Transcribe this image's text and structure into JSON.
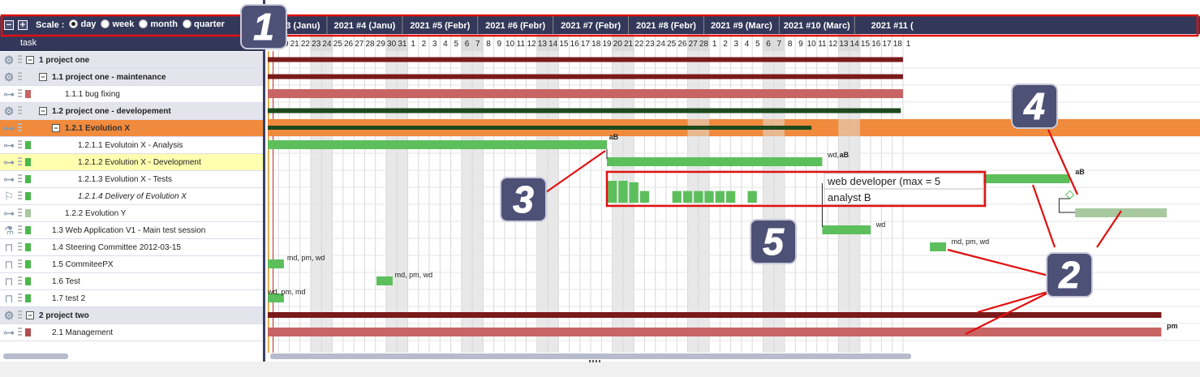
{
  "toolbar": {
    "collapse_label": "−",
    "expand_label": "+",
    "scale_label": "Scale :",
    "scale_options": [
      {
        "label": "day",
        "checked": true
      },
      {
        "label": "week",
        "checked": false
      },
      {
        "label": "month",
        "checked": false
      },
      {
        "label": "quarter",
        "checked": false
      }
    ]
  },
  "task_header": "task",
  "weeks": [
    "2021 #3 (Janu)",
    "2021 #4 (Janu)",
    "2021 #5 (Febr)",
    "2021 #6 (Febr)",
    "2021 #7 (Febr)",
    "2021 #8 (Febr)",
    "2021 #9 (Marc)",
    "2021 #10 (Marc)",
    "2021 #11 ("
  ],
  "days": [
    "19",
    "20",
    "21",
    "22",
    "23",
    "24",
    "25",
    "26",
    "27",
    "28",
    "29",
    "30",
    "31",
    "1",
    "2",
    "3",
    "4",
    "5",
    "6",
    "7",
    "8",
    "9",
    "10",
    "11",
    "12",
    "13",
    "14",
    "15",
    "16",
    "17",
    "18",
    "19",
    "20",
    "21",
    "22",
    "23",
    "24",
    "25",
    "26",
    "27",
    "28",
    "1",
    "2",
    "3",
    "4",
    "5",
    "6",
    "7",
    "8",
    "9",
    "10",
    "11",
    "12",
    "13",
    "14",
    "15",
    "16",
    "17",
    "18",
    "1"
  ],
  "weekend_day_indices": [
    4,
    5,
    11,
    12,
    18,
    19,
    25,
    26,
    32,
    33,
    39,
    40,
    46,
    47,
    53,
    54
  ],
  "tasks": [
    {
      "label": "1 project one",
      "level": 0,
      "group": true,
      "icon": "gear",
      "color": "#7a1a1a",
      "toggle": "−"
    },
    {
      "label": "1.1 project one - maintenance",
      "level": 1,
      "group": true,
      "icon": "gear",
      "color": "#7a1a1a",
      "toggle": "−"
    },
    {
      "label": "1.1.1 bug fixing",
      "level": 2,
      "icon": "tree",
      "color": "#c86464"
    },
    {
      "label": "1.2 project one - developement",
      "level": 1,
      "group": true,
      "icon": "gear",
      "color": "#1d4a1d",
      "toggle": "−"
    },
    {
      "label": "1.2.1 Evolution X",
      "level": 2,
      "group": true,
      "selected": true,
      "icon": "tree",
      "color": "#1d4a1d",
      "toggle": "−"
    },
    {
      "label": "1.2.1.1 Evolutoin X - Analysis",
      "level": 3,
      "icon": "tree",
      "color": "#4cb84c"
    },
    {
      "label": "1.2.1.2 Evolution X - Development",
      "level": 3,
      "highlight": true,
      "icon": "tree",
      "color": "#4cb84c"
    },
    {
      "label": "1.2.1.3 Evolution X - Tests",
      "level": 3,
      "icon": "tree",
      "color": "#4cb84c"
    },
    {
      "label": "1.2.1.4 Delivery of Evolution X",
      "level": 3,
      "italic": true,
      "icon": "flag",
      "color": "#4cb84c"
    },
    {
      "label": "1.2.2 Evolution Y",
      "level": 2,
      "icon": "tree",
      "color": "#a8c8a0"
    },
    {
      "label": "1.3 Web Application V1 - Main test session",
      "level": 1,
      "icon": "flask",
      "color": "#4cb84c"
    },
    {
      "label": "1.4 Steering Committee 2012-03-15",
      "level": 1,
      "icon": "table",
      "color": "#4cb84c"
    },
    {
      "label": "1.5 CommiteePX",
      "level": 1,
      "icon": "table",
      "color": "#4cb84c"
    },
    {
      "label": "1.6 Test",
      "level": 1,
      "icon": "table",
      "color": "#4cb84c"
    },
    {
      "label": "1.7 test 2",
      "level": 1,
      "icon": "table",
      "color": "#4cb84c"
    },
    {
      "label": "2 project two",
      "level": 0,
      "group": true,
      "icon": "gear",
      "color": "#7a1a1a",
      "toggle": "−"
    },
    {
      "label": "2.1 Management",
      "level": 1,
      "icon": "tree",
      "color": "#b05050"
    }
  ],
  "resource_labels": {
    "ab1": "aB",
    "wdab": "wd, ",
    "wdab_b": "aB",
    "ab2": "aB",
    "wd": "wd",
    "mdpmwd1": "md, pm, wd",
    "mdpmwd2": "md, pm, wd",
    "mdpmwd3": "md, pm, wd",
    "wdpmmd": "wd, pm, md",
    "pm": "pm"
  },
  "tooltip": {
    "line1": "web developer (max = 5",
    "line2": "analyst B"
  },
  "load_bars": [
    0.75,
    0.75,
    0.7,
    0.4,
    0,
    0,
    0.4,
    0.4,
    0.4,
    0.4,
    0.4,
    0.4,
    0,
    0.4
  ],
  "callouts": [
    "1",
    "2",
    "3",
    "4",
    "5"
  ],
  "colors": {
    "header": "#33385a",
    "callout_fill": "#4e5176",
    "callout_border": "#c8c8d8",
    "highlight_red": "#e01010",
    "green": "#5cbf5c",
    "dark_red": "#7a1a1a",
    "pink": "#c86464",
    "dark_green": "#1d4a1d",
    "orange": "#f08a3c",
    "light_green": "#a8c8a0"
  }
}
